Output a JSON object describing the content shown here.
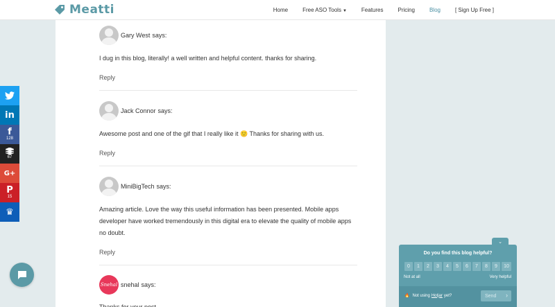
{
  "header": {
    "logo": "Meatti",
    "nav": [
      "Home",
      "Free ASO Tools",
      "Features",
      "Pricing",
      "Blog",
      "[ Sign Up Free ]"
    ],
    "active_nav": "Blog",
    "accent_color": "#5b9aa6"
  },
  "comments": [
    {
      "author": "Gary West",
      "says": "says:",
      "text": "I dug in this blog, literally! a well written and helpful content. thanks for sharing.",
      "reply": "Reply"
    },
    {
      "author": "Jack Connor",
      "says": "says:",
      "text": "Awesome post and one of the gif that I really like it 🙂 Thanks for sharing with us.",
      "reply": "Reply"
    },
    {
      "author": "MiniBigTech",
      "says": "says:",
      "text": "Amazing article. Love the way this useful information has been presented. Mobile apps developer have worked tremendously in this digital era to elevate the quality of mobile apps no doubt.",
      "reply": "Reply"
    },
    {
      "author": "snehal",
      "says": "says:",
      "avatar_text": "Snehal",
      "text": "Thanks for your post",
      "reply": ""
    }
  ],
  "social": [
    {
      "network": "twitter",
      "icon": "twitter-icon",
      "color": "#1da1f2",
      "glyph": "🐦",
      "count": ""
    },
    {
      "network": "linkedin",
      "icon": "linkedin-icon",
      "color": "#0077b5",
      "glyph": "in",
      "count": ""
    },
    {
      "network": "facebook",
      "icon": "facebook-icon",
      "color": "#3b5998",
      "glyph": "f",
      "count": "128"
    },
    {
      "network": "buffer",
      "icon": "buffer-icon",
      "color": "#222222",
      "glyph": "≡",
      "count": "67"
    },
    {
      "network": "google-plus",
      "icon": "google-plus-icon",
      "color": "#dd4b39",
      "glyph": "G+",
      "count": ""
    },
    {
      "network": "pinterest",
      "icon": "pinterest-icon",
      "color": "#cb2027",
      "glyph": "P",
      "count": "15"
    },
    {
      "network": "crown",
      "icon": "crown-icon",
      "color": "#0e5eb8",
      "glyph": "♛",
      "count": ""
    }
  ],
  "feedback": {
    "title": "Do you find this blog helpful?",
    "scale": [
      "0",
      "1",
      "2",
      "3",
      "4",
      "5",
      "6",
      "7",
      "8",
      "9",
      "10"
    ],
    "low_label": "Not at all",
    "high_label": "Very helpful",
    "note": "Not using",
    "note_link": "Hotjar",
    "note_suffix": "yet?",
    "send": "Send"
  }
}
